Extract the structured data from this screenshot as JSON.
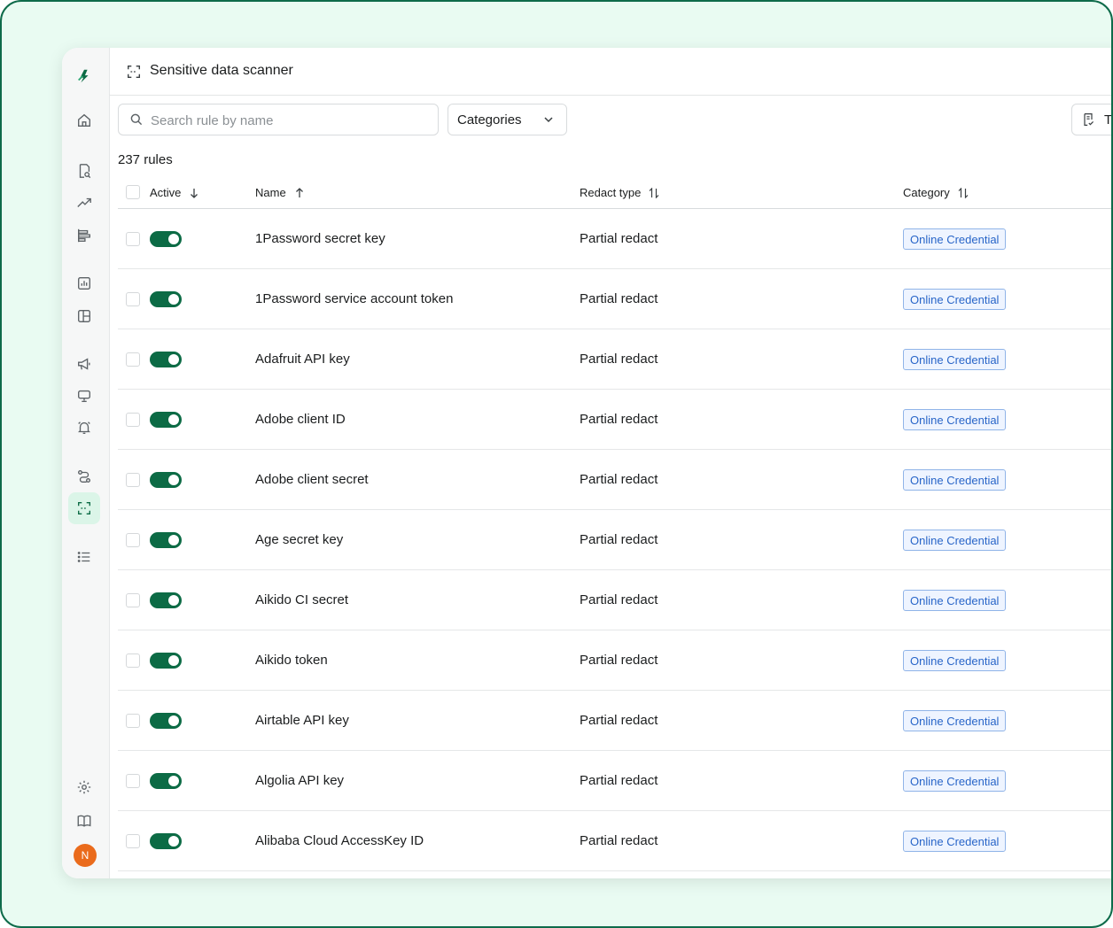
{
  "header": {
    "title": "Sensitive data scanner"
  },
  "toolbar": {
    "search_placeholder": "Search rule by name",
    "categories_label": "Categories",
    "right_button_label": "T"
  },
  "rules_count": "237 rules",
  "table": {
    "columns": {
      "active": "Active",
      "name": "Name",
      "redact_type": "Redact type",
      "category": "Category"
    },
    "rows": [
      {
        "name": "1Password secret key",
        "redact": "Partial redact",
        "category": "Online Credential",
        "active": true
      },
      {
        "name": "1Password service account token",
        "redact": "Partial redact",
        "category": "Online Credential",
        "active": true
      },
      {
        "name": "Adafruit API key",
        "redact": "Partial redact",
        "category": "Online Credential",
        "active": true
      },
      {
        "name": "Adobe client ID",
        "redact": "Partial redact",
        "category": "Online Credential",
        "active": true
      },
      {
        "name": "Adobe client secret",
        "redact": "Partial redact",
        "category": "Online Credential",
        "active": true
      },
      {
        "name": "Age secret key",
        "redact": "Partial redact",
        "category": "Online Credential",
        "active": true
      },
      {
        "name": "Aikido CI secret",
        "redact": "Partial redact",
        "category": "Online Credential",
        "active": true
      },
      {
        "name": "Aikido token",
        "redact": "Partial redact",
        "category": "Online Credential",
        "active": true
      },
      {
        "name": "Airtable API key",
        "redact": "Partial redact",
        "category": "Online Credential",
        "active": true
      },
      {
        "name": "Algolia API key",
        "redact": "Partial redact",
        "category": "Online Credential",
        "active": true
      },
      {
        "name": "Alibaba Cloud AccessKey ID",
        "redact": "Partial redact",
        "category": "Online Credential",
        "active": true
      }
    ]
  },
  "user": {
    "initial": "N"
  },
  "colors": {
    "brand": "#0c6b45",
    "frame_bg": "#e9fbf2",
    "badge_text": "#2865c8",
    "avatar": "#ea6b1c"
  }
}
